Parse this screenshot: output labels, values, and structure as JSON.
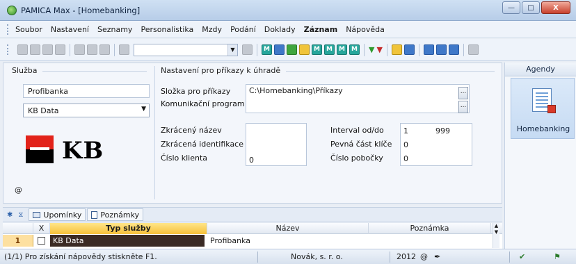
{
  "window": {
    "title": "PAMICA Max - [Homebanking]",
    "min_glyph": "—",
    "max_glyph": "□",
    "close_glyph": "X"
  },
  "menu": {
    "items": [
      "Soubor",
      "Nastavení",
      "Seznamy",
      "Personalistika",
      "Mzdy",
      "Podání",
      "Doklady",
      "Záznam",
      "Nápověda"
    ],
    "bold_item": "Záznam"
  },
  "toolbar": {
    "combo_value": "",
    "icons": [
      "tree-icon",
      "cut-icon",
      "copy-icon",
      "preview-icon",
      "new-icon",
      "save-icon",
      "save-as-icon",
      "paste-icon",
      "filter-icon",
      "m-icon",
      "calc-icon",
      "person-icon",
      "smile-icon",
      "mail-icon",
      "flag-green-icon",
      "flag-red-icon",
      "folder-icon",
      "grid-icon",
      "help-icon"
    ],
    "flag_green": "▼",
    "flag_red": "▼"
  },
  "sluzba": {
    "title": "Služba",
    "bank_name": "Profibanka",
    "bank_type": "KB Data",
    "logo_text": "KB",
    "at_symbol": "@"
  },
  "nastaveni": {
    "title": "Nastavení pro příkazy k úhradě",
    "slozka_label": "Složka pro příkazy",
    "slozka_value": "C:\\Homebanking\\Příkazy",
    "komunikacni_label": "Komunikační program",
    "komunikacni_value": "",
    "zkraceny_nazev_label": "Zkrácený název",
    "zkracena_ident_label": "Zkrácená identifikace",
    "cislo_klienta_label": "Číslo klienta",
    "cislo_klienta_value": "0",
    "interval_label": "Interval od/do",
    "interval_od": "1",
    "interval_do": "999",
    "pevna_cast_label": "Pevná část klíče",
    "pevna_cast_value": "0",
    "cislo_pobocky_label": "Číslo pobočky",
    "cislo_pobocky_value": "0",
    "dots": "..."
  },
  "agendy": {
    "title": "Agendy",
    "items": [
      "Homebanking"
    ]
  },
  "tabs": {
    "star": "✱",
    "upominky": "Upomínky",
    "poznamky": "Poznámky",
    "filter_glyph": "⧖"
  },
  "grid": {
    "headers": [
      "X",
      "Typ služby",
      "Název",
      "Poznámka"
    ],
    "rows": [
      {
        "num": "1",
        "typ": "KB Data",
        "nazev": "Profibanka",
        "poznamka": ""
      }
    ]
  },
  "status": {
    "help": "(1/1) Pro získání nápovědy stiskněte F1.",
    "company": "Novák, s. r. o.",
    "year": "2012",
    "at": "@"
  },
  "colors": {
    "kb_red": "#e2231a",
    "grid_active_header": "#f6c13a",
    "row_highlight": "#3a2a24"
  }
}
